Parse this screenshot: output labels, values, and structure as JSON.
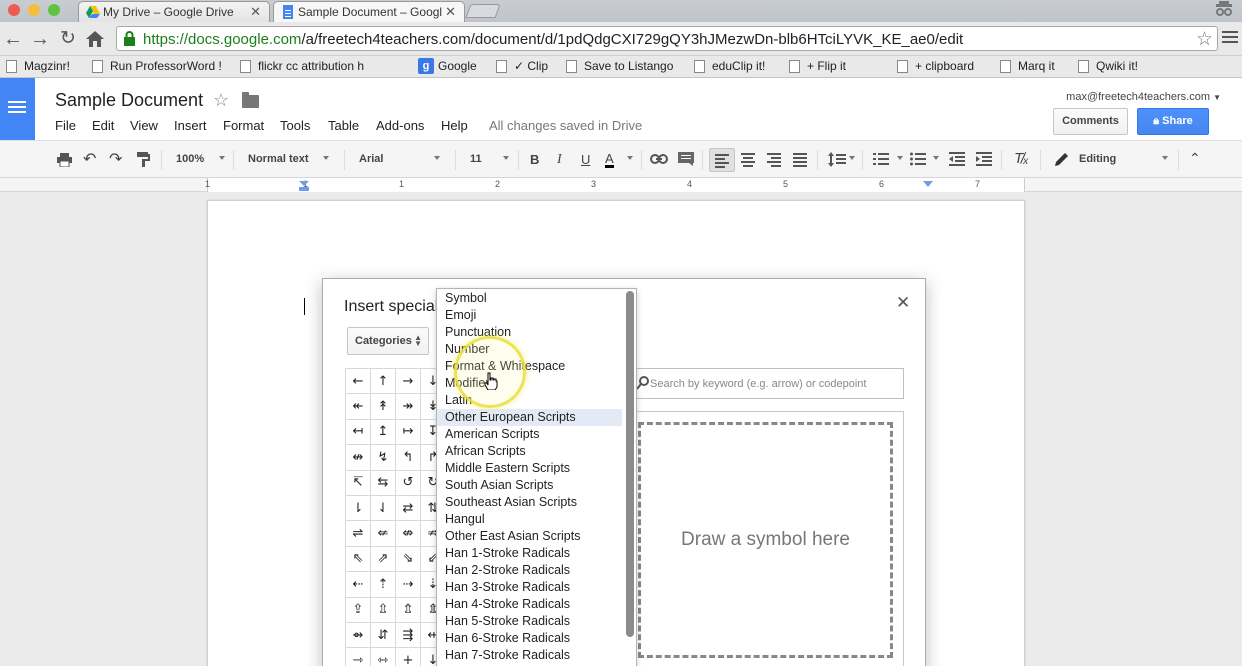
{
  "browser": {
    "tabs": [
      {
        "title": "My Drive – Google Drive"
      },
      {
        "title": "Sample Document – Googl"
      }
    ],
    "url_secure": "https://docs.google.com",
    "url_rest": "/a/freetech4teachers.com/document/d/1pdQdgCXI729gQY3hJMezwDn-blb6HTciLYVK_KE_ae0/edit",
    "bookmarks": [
      "Magzinr!",
      "Run ProfessorWord !",
      "flickr cc attribution h",
      "Google",
      "✓ Clip",
      "Save to Listango",
      "eduClip it!",
      "+ Flip it",
      "+ clipboard",
      "Marq it",
      "Qwiki it!"
    ]
  },
  "docs": {
    "title": "Sample Document",
    "menu": [
      "File",
      "Edit",
      "View",
      "Insert",
      "Format",
      "Tools",
      "Table",
      "Add-ons",
      "Help"
    ],
    "save_status": "All changes saved in Drive",
    "account": "max@freetech4teachers.com",
    "comments_label": "Comments",
    "share_label": "Share"
  },
  "toolbar": {
    "zoom": "100%",
    "style": "Normal text",
    "font": "Arial",
    "size": "11",
    "bold": "B",
    "italic": "I",
    "underline": "U",
    "text_color": "A",
    "mode": "Editing"
  },
  "ruler": {
    "numbers": [
      "1",
      "1",
      "1",
      "2",
      "3",
      "4",
      "5",
      "6",
      "7"
    ]
  },
  "dialog": {
    "title": "Insert special characters",
    "categories_label": "Categories",
    "search_placeholder": "Search by keyword (e.g. arrow) or codepoint",
    "draw_label": "Draw a symbol here",
    "symbols": [
      [
        "←",
        "↑",
        "→",
        "↓"
      ],
      [
        "↞",
        "↟",
        "↠",
        "↡"
      ],
      [
        "↤",
        "↥",
        "↦",
        "↧"
      ],
      [
        "↮",
        "↯",
        "↰",
        "↱"
      ],
      [
        "↸",
        "⇆",
        "↺",
        "↻"
      ],
      [
        "⇂",
        "⇃",
        "⇄",
        "⇅"
      ],
      [
        "⇌",
        "⇍",
        "⇎",
        "⇏"
      ],
      [
        "⇖",
        "⇗",
        "⇘",
        "⇙"
      ],
      [
        "⇠",
        "⇡",
        "⇢",
        "⇣"
      ],
      [
        "⇪",
        "⇫",
        "⇬",
        "⇭"
      ],
      [
        "⇴",
        "⇵",
        "⇶",
        "⇷"
      ],
      [
        "⇾",
        "⇿",
        "+",
        "↓"
      ]
    ]
  },
  "category_menu": {
    "items": [
      "Symbol",
      "Emoji",
      "Punctuation",
      "Number",
      "Format & Whitespace",
      "Modifier",
      "Latin",
      "Other European Scripts",
      "American Scripts",
      "African Scripts",
      "Middle Eastern Scripts",
      "South Asian Scripts",
      "Southeast Asian Scripts",
      "Hangul",
      "Other East Asian Scripts",
      "Han 1-Stroke Radicals",
      "Han 2-Stroke Radicals",
      "Han 3-Stroke Radicals",
      "Han 4-Stroke Radicals",
      "Han 5-Stroke Radicals",
      "Han 6-Stroke Radicals",
      "Han 7-Stroke Radicals"
    ],
    "highlighted": "Other European Scripts"
  },
  "colors": {
    "docs_blue": "#4285f4",
    "share_blue": "#4d90fe",
    "secure_url_green": "#1c7f1c",
    "highlight": "#e3eaf6",
    "cursor_ring": "#e9e137"
  },
  "icons": [
    "back-icon",
    "forward-icon",
    "reload-icon",
    "home-icon",
    "lock-icon",
    "star-icon",
    "menu-icon",
    "print-icon",
    "undo-icon",
    "redo-icon",
    "paint-format-icon",
    "link-icon",
    "comment-icon",
    "align-left-icon",
    "align-center-icon",
    "align-right-icon",
    "justify-icon",
    "line-spacing-icon",
    "numbered-list-icon",
    "bulleted-list-icon",
    "indent-decrease-icon",
    "indent-increase-icon",
    "clear-formatting-icon",
    "pencil-icon",
    "collapse-icon",
    "close-icon",
    "search-icon"
  ]
}
